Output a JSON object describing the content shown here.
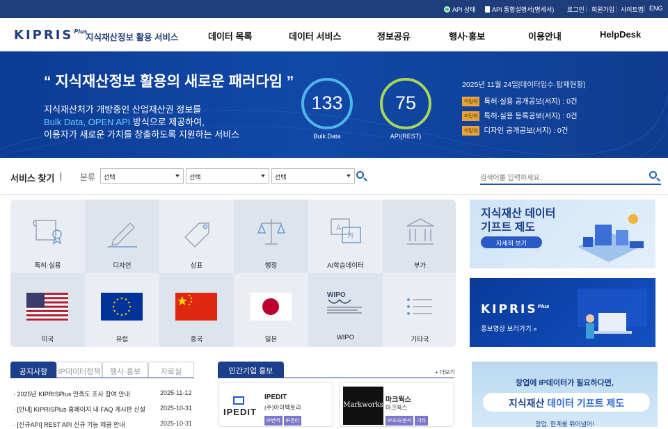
{
  "topbar": {
    "api_status": "API 상태",
    "api_spec": "API 통합설명서(명세서)",
    "login": "로그인",
    "signup": "회원가입",
    "sitemap": "사이트맵",
    "eng": "ENG"
  },
  "header": {
    "logo_text": "KIPRIS",
    "logo_plus": "Plus",
    "subtitle": "지식재산정보 활용 서비스",
    "nav": [
      "데이터 목록",
      "데이터 서비스",
      "정보공유",
      "행사·홍보",
      "이용안내",
      "HelpDesk"
    ]
  },
  "hero": {
    "title": "“ 지식재산정보 활용의 새로운 패러다임 ”",
    "desc1": "지식재산처가 개방중인 산업재산권 정보를",
    "desc2_hl": "Bulk Data, OPEN API",
    "desc2_rest": " 방식으로 제공하여,",
    "desc3": "이용자가 새로운 가치를 창출하도록 지원하는 서비스",
    "bulk_count": "133",
    "bulk_label": "Bulk Data",
    "api_count": "75",
    "api_label": "API(REST)",
    "stats_date": "2025년 11월 24일[데이터입수·탑재현황]",
    "stat_tag": "미탑재",
    "stats": [
      "특허·실용 공개공보(서지) : 0건",
      "특허·실용 등록공보(서지) : 0건",
      "디자인 공개공보(서지) : 0건"
    ]
  },
  "search": {
    "label": "서비스 찾기",
    "category": "분류",
    "selects": [
      "선택",
      "선택",
      "선택"
    ],
    "placeholder": "검색어를 입력하세요."
  },
  "grid": {
    "items": [
      "특허·실용",
      "디자인",
      "상표",
      "행정",
      "AI학습데이터",
      "부가",
      "미국",
      "유럽",
      "중국",
      "일본",
      "WIPO",
      "기타국"
    ]
  },
  "banners": {
    "gift_title1": "지식재산 데이터",
    "gift_title2": "기프트 제도",
    "gift_btn": "자세히 보기",
    "promo_logo": "KIPRIS",
    "promo_plus": "Plus",
    "promo_sub": "홍보영상 보러가기 »",
    "startup_l1": "창업에 IP데이터가 필요하다면,",
    "startup_l2a": "지식재산 ",
    "startup_l2b": "데이터 기프트 제도",
    "startup_l3": "창업, 한계를 뛰어넘어!"
  },
  "notice": {
    "tabs": [
      "공지사항",
      "IP데이터정책",
      "행사·홍보",
      "자료실"
    ],
    "items": [
      {
        "title": "· 2025년 KIPRISPlus 만족도 조사 참여 안내",
        "date": "2025-11-12"
      },
      {
        "title": "· [안내] KIPRISPlus 홈페이지 내 FAQ 게시판 신설",
        "date": "2025-10-31"
      },
      {
        "title": "· [신규API] REST API 신규 기능 제공 안내",
        "date": "2025-10-31"
      }
    ]
  },
  "promo": {
    "title": "민간기업 홍보",
    "more": "+ 더보기",
    "cards": [
      {
        "logo": "IPEDIT",
        "name": "IPEDIT",
        "corp": "(주)아이펙토리",
        "tags": [
          "IP번역",
          "IP관리"
        ]
      },
      {
        "logo": "Markworks",
        "name": "마크웍스",
        "corp": "마크웍스",
        "tags": [
          "IP조사/분석",
          "기타"
        ]
      }
    ]
  },
  "colors": {
    "navy": "#1e3d7a",
    "hero": "#1148a8",
    "ring_bulk": "#4fb7e8",
    "ring_api": "#a8d65a",
    "tag": "#e8a33a"
  }
}
